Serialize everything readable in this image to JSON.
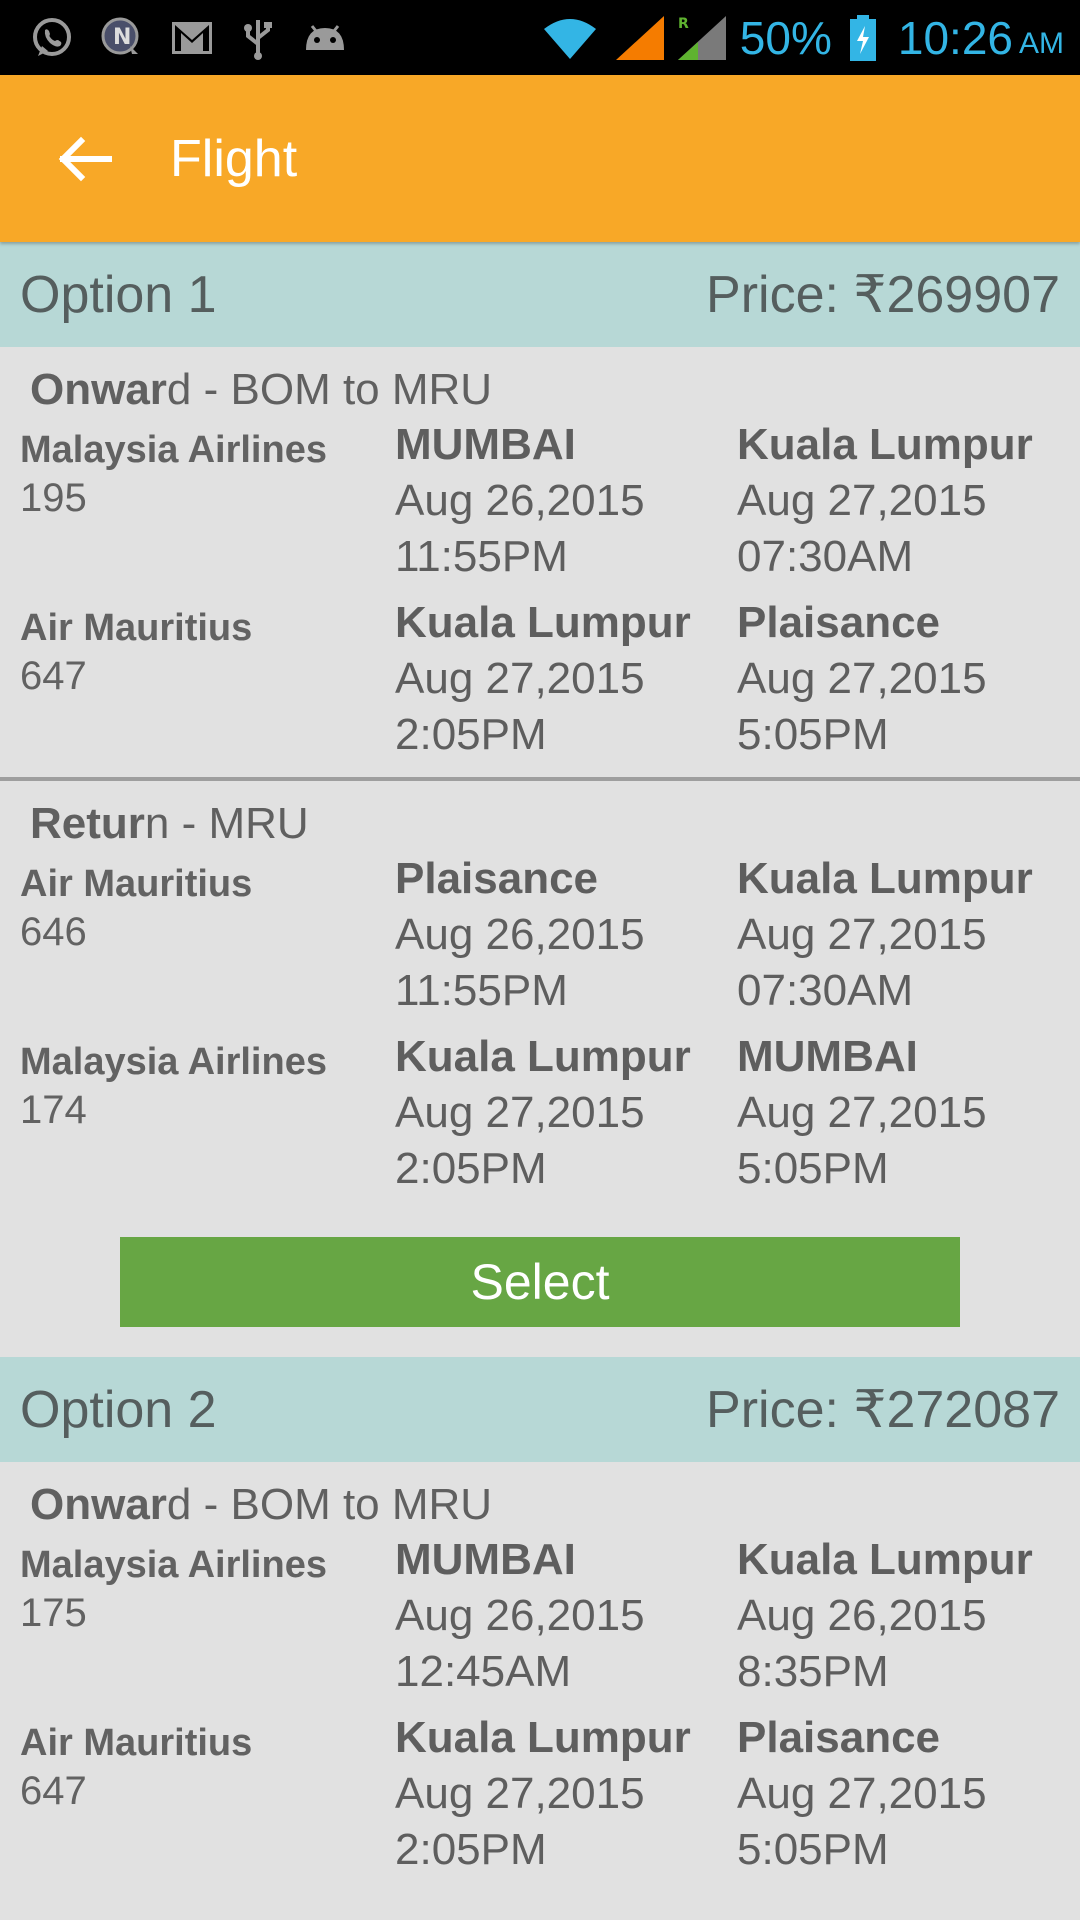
{
  "status_bar": {
    "icons_left": [
      "whatsapp-icon",
      "notification-n-icon",
      "gmail-icon",
      "usb-icon",
      "android-debug-icon"
    ],
    "icons_right": [
      "wifi-icon",
      "signal-icon",
      "roaming-signal-icon",
      "battery-charging-icon"
    ],
    "battery": "50%",
    "time": "10:26",
    "ampm": "AM",
    "colors": {
      "background": "#000000",
      "text": "#33b5e5"
    }
  },
  "app_bar": {
    "title": "Flight",
    "back_icon": "arrow-left-icon",
    "color": "#f8a827"
  },
  "options": [
    {
      "title": "Option 1",
      "price": "Price: ₹269907",
      "onward": {
        "label_bold": "Onwar",
        "label_rest": "d - BOM to MRU",
        "legs": [
          {
            "airline": "Malaysia Airlines",
            "flight_no": "195",
            "from_city": "MUMBAI",
            "from_date": "Aug 26,2015",
            "from_time": "11:55PM",
            "to_city": "Kuala Lumpur",
            "to_date": "Aug 27,2015",
            "to_time": "07:30AM"
          },
          {
            "airline": "Air Mauritius",
            "flight_no": "647",
            "from_city": "Kuala Lumpur",
            "from_date": "Aug 27,2015",
            "from_time": "2:05PM",
            "to_city": "Plaisance",
            "to_date": "Aug 27,2015",
            "to_time": "5:05PM"
          }
        ]
      },
      "return": {
        "label_bold": "Retur",
        "label_rest": "n - MRU",
        "legs": [
          {
            "airline": "Air Mauritius",
            "flight_no": "646",
            "from_city": "Plaisance",
            "from_date": "Aug 26,2015",
            "from_time": "11:55PM",
            "to_city": "Kuala Lumpur",
            "to_date": "Aug 27,2015",
            "to_time": "07:30AM"
          },
          {
            "airline": "Malaysia Airlines",
            "flight_no": "174",
            "from_city": "Kuala Lumpur",
            "from_date": "Aug 27,2015",
            "from_time": "2:05PM",
            "to_city": "MUMBAI",
            "to_date": "Aug 27,2015",
            "to_time": "5:05PM"
          }
        ]
      },
      "select_label": "Select"
    },
    {
      "title": "Option 2",
      "price": "Price: ₹272087",
      "onward": {
        "label_bold": "Onwar",
        "label_rest": "d - BOM to MRU",
        "legs": [
          {
            "airline": "Malaysia Airlines",
            "flight_no": "175",
            "from_city": "MUMBAI",
            "from_date": "Aug 26,2015",
            "from_time": "12:45AM",
            "to_city": "Kuala Lumpur",
            "to_date": "Aug 26,2015",
            "to_time": "8:35PM"
          },
          {
            "airline": "Air Mauritius",
            "flight_no": "647",
            "from_city": "Kuala Lumpur",
            "from_date": "Aug 27,2015",
            "from_time": "2:05PM",
            "to_city": "Plaisance",
            "to_date": "Aug 27,2015",
            "to_time": "5:05PM"
          }
        ]
      }
    }
  ],
  "colors": {
    "option_header": "#b7d8d6",
    "body_background": "#e1e1e1",
    "select_button": "#67a644"
  }
}
